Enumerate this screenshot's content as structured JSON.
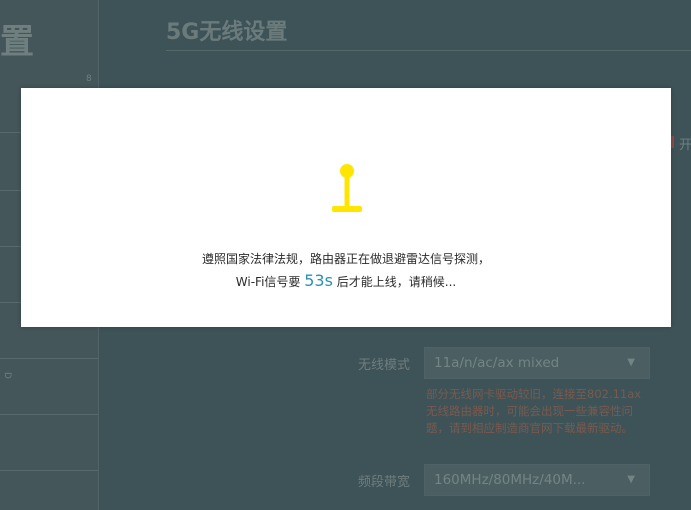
{
  "sidebar": {
    "title_fragment": "置",
    "scroll_mark": "8",
    "side_mark": "D"
  },
  "page": {
    "title": "5G无线设置",
    "edge_text": "开"
  },
  "fields": {
    "mode": {
      "label": "无线模式",
      "value": "11a/n/ac/ax mixed"
    },
    "mode_hint": "部分无线网卡驱动较旧，连接至802.11ax无线路由器时，可能会出现一些兼容性问题，请到相应制造商官网下载最新驱动。",
    "bandwidth": {
      "label": "频段带宽",
      "value": "160MHz/80MHz/40M..."
    }
  },
  "modal": {
    "line1": "遵照国家法律法规，路由器正在做退避雷达信号探测，",
    "line2_before": "Wi-Fi信号要 ",
    "countdown": "53s",
    "line2_after": " 后才能上线，请稍候...",
    "icon": "radar-antenna-icon",
    "icon_color": "#ffe500"
  }
}
